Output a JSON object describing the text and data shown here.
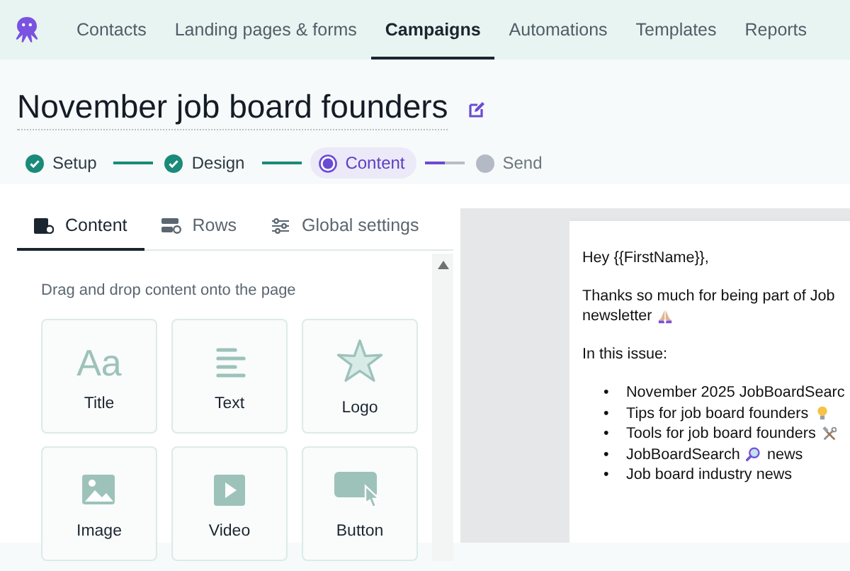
{
  "nav": {
    "items": [
      {
        "label": "Contacts",
        "selected": false
      },
      {
        "label": "Landing pages & forms",
        "selected": false
      },
      {
        "label": "Campaigns",
        "selected": true
      },
      {
        "label": "Automations",
        "selected": false
      },
      {
        "label": "Templates",
        "selected": false
      },
      {
        "label": "Reports",
        "selected": false
      }
    ]
  },
  "campaign": {
    "title": "November job board founders"
  },
  "steps": [
    {
      "label": "Setup",
      "kind": "done"
    },
    {
      "label": "Design",
      "kind": "done"
    },
    {
      "label": "Content",
      "kind": "current"
    },
    {
      "label": "Send",
      "kind": "todo"
    }
  ],
  "editor_tabs": [
    {
      "label": "Content",
      "kind": "content",
      "selected": true
    },
    {
      "label": "Rows",
      "kind": "rows",
      "selected": false
    },
    {
      "label": "Global settings",
      "kind": "settings",
      "selected": false
    }
  ],
  "panel": {
    "hint": "Drag and drop content onto the page",
    "blocks": [
      {
        "label": "Title",
        "kind": "title",
        "glyph": "Aa"
      },
      {
        "label": "Text",
        "kind": "text"
      },
      {
        "label": "Logo",
        "kind": "logo"
      },
      {
        "label": "Image",
        "kind": "image"
      },
      {
        "label": "Video",
        "kind": "video"
      },
      {
        "label": "Button",
        "kind": "button"
      }
    ]
  },
  "email": {
    "greeting": "Hey {{FirstName}},",
    "intro_lines": [
      [
        {
          "kind": "text",
          "text": "Thanks so much for being part of Job"
        }
      ],
      [
        {
          "kind": "text",
          "text": "newsletter"
        },
        {
          "kind": "pray"
        }
      ]
    ],
    "issue_heading": "In this issue:",
    "items": [
      {
        "marker": "•",
        "parts": [
          {
            "kind": "text",
            "text": "November 2025 JobBoardSearc"
          }
        ]
      },
      {
        "marker": "•",
        "parts": [
          {
            "kind": "text",
            "text": "Tips for job board founders"
          },
          {
            "kind": "bulb"
          }
        ]
      },
      {
        "marker": "•",
        "parts": [
          {
            "kind": "text",
            "text": "Tools for job board founders"
          },
          {
            "kind": "tools"
          }
        ]
      },
      {
        "marker": "•",
        "parts": [
          {
            "kind": "text",
            "text": "JobBoardSearch"
          },
          {
            "kind": "magnifier"
          },
          {
            "kind": "text",
            "text": "news"
          }
        ]
      },
      {
        "marker": "•",
        "parts": [
          {
            "kind": "text",
            "text": "Job board industry news"
          }
        ]
      }
    ]
  }
}
